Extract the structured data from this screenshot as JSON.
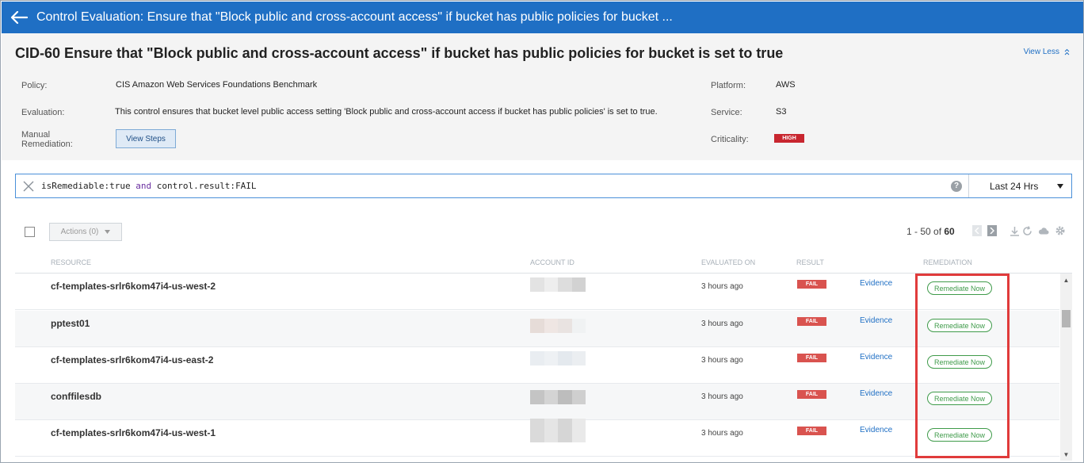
{
  "header": {
    "title": "Control Evaluation: Ensure that \"Block public and cross-account access\" if bucket has public policies for bucket ..."
  },
  "control": {
    "title": "CID-60 Ensure that \"Block public and cross-account access\" if bucket has public policies for bucket is set to true",
    "view_less": "View Less",
    "policy_label": "Policy:",
    "policy": "CIS Amazon Web Services Foundations Benchmark",
    "evaluation_label": "Evaluation:",
    "evaluation": "This control ensures that bucket level public access setting 'Block public and cross-account access if bucket has public policies' is set to true.",
    "manual_label_line1": "Manual",
    "manual_label_line2": "Remediation:",
    "view_steps": "View Steps",
    "platform_label": "Platform:",
    "platform": "AWS",
    "service_label": "Service:",
    "service": "S3",
    "criticality_label": "Criticality:",
    "criticality": "HIGH"
  },
  "search": {
    "query_key1": "isRemediable:",
    "query_val1": "true",
    "query_op": " and ",
    "query_key2": "control.result:",
    "query_val2": "FAIL",
    "help": "?",
    "range": "Last 24 Hrs"
  },
  "toolbar": {
    "actions": "Actions (0)",
    "pager_range": "1 - 50 of ",
    "pager_total": "60"
  },
  "table": {
    "columns": {
      "resource": "RESOURCE",
      "account": "ACCOUNT ID",
      "evaluated": "EVALUATED ON",
      "result": "RESULT",
      "remediation": "REMEDIATION"
    },
    "rows": [
      {
        "resource": "cf-templates-srlr6kom47i4-us-west-2",
        "evaluated": "3 hours ago",
        "result": "FAIL",
        "evidence": "Evidence",
        "remediate": "Remediate Now"
      },
      {
        "resource": "pptest01",
        "evaluated": "3 hours ago",
        "result": "FAIL",
        "evidence": "Evidence",
        "remediate": "Remediate Now"
      },
      {
        "resource": "cf-templates-srlr6kom47i4-us-east-2",
        "evaluated": "3 hours ago",
        "result": "FAIL",
        "evidence": "Evidence",
        "remediate": "Remediate Now"
      },
      {
        "resource": "conffilesdb",
        "evaluated": "3 hours ago",
        "result": "FAIL",
        "evidence": "Evidence",
        "remediate": "Remediate Now"
      },
      {
        "resource": "cf-templates-srlr6kom47i4-us-west-1",
        "evaluated": "3 hours ago",
        "result": "FAIL",
        "evidence": "Evidence",
        "remediate": "Remediate Now"
      }
    ]
  },
  "colors": {
    "header_blue": "#1f6fc4",
    "fail_red": "#d9534f",
    "high_red": "#c8262f",
    "remediate_green": "#3f9b4a",
    "highlight_red": "#e03b3b"
  },
  "icons": [
    "back-arrow-icon",
    "chevron-up-icon",
    "clear-x-icon",
    "help-icon",
    "dropdown-caret-icon",
    "download-icon",
    "refresh-icon",
    "cloud-icon",
    "gear-icon"
  ]
}
